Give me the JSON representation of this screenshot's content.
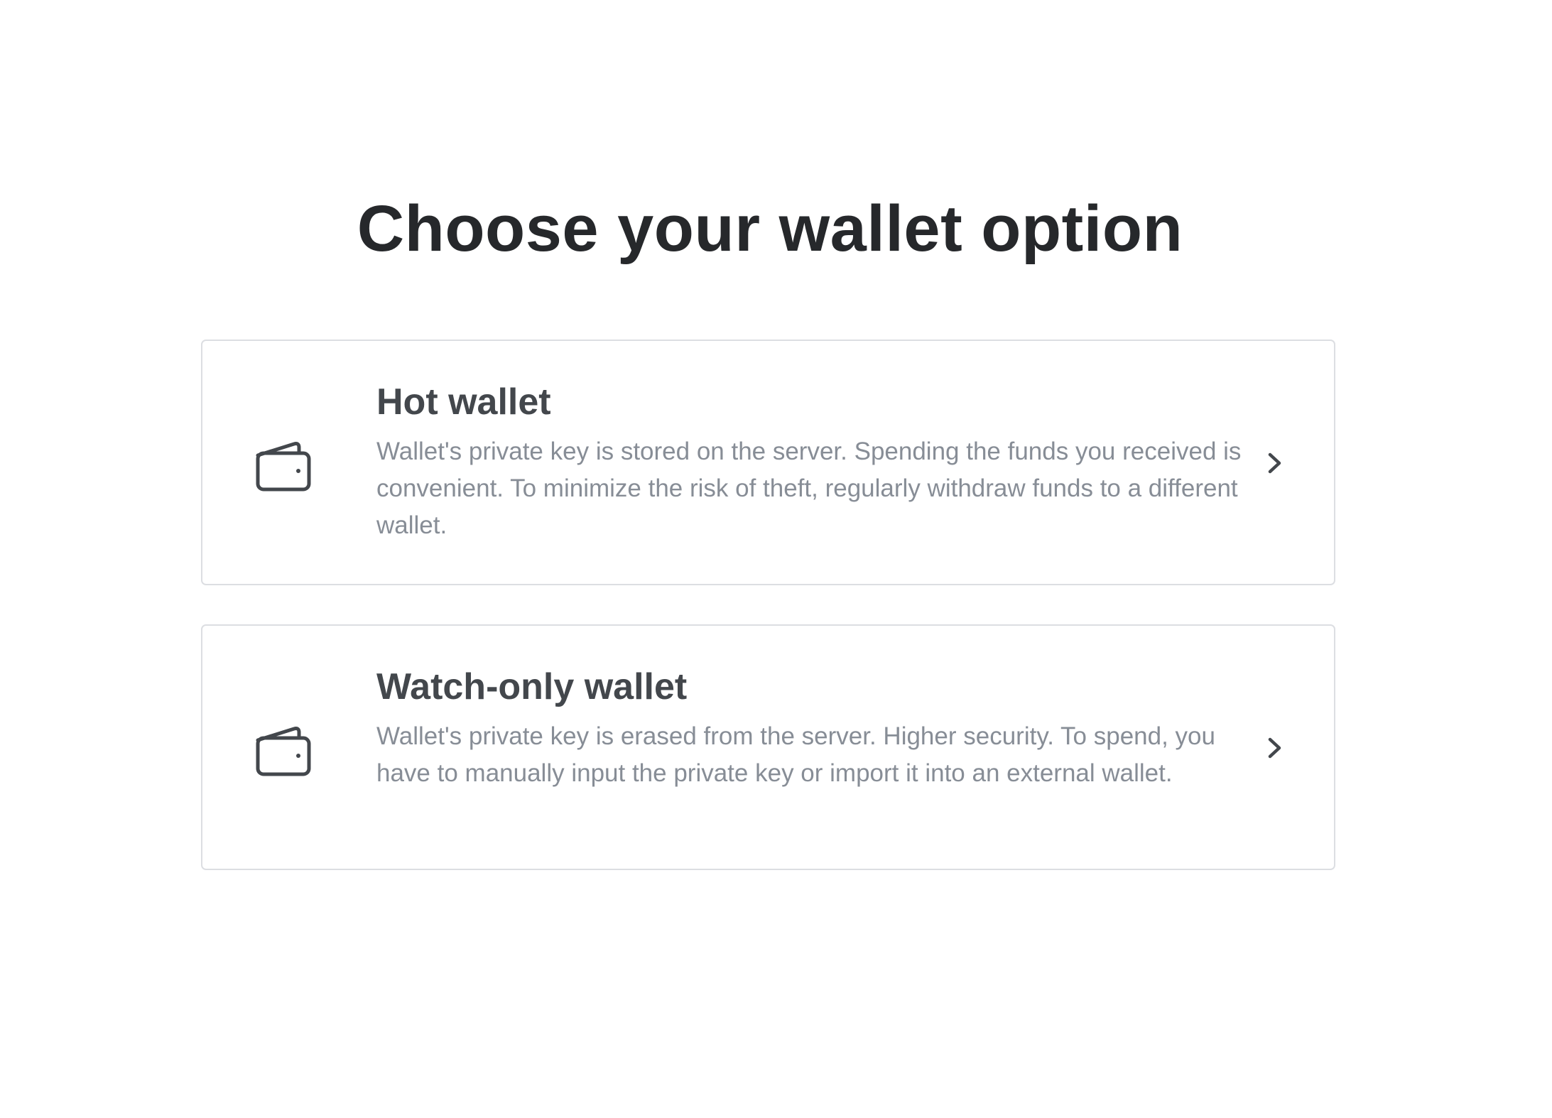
{
  "page": {
    "title": "Choose your wallet option"
  },
  "options": [
    {
      "icon": "wallet-icon",
      "title": "Hot wallet",
      "description": "Wallet's private key is stored on the server. Spending the funds you received is convenient. To minimize the risk of theft, regularly withdraw funds to a different wallet.",
      "action_icon": "chevron-right-icon"
    },
    {
      "icon": "wallet-icon",
      "title": "Watch-only wallet",
      "description": "Wallet's private key is erased from the server. Higher security. To spend, you have to manually input the private key or import it into an external wallet.",
      "action_icon": "chevron-right-icon"
    }
  ],
  "colors": {
    "title": "#26282b",
    "card_title": "#43474c",
    "description": "#878d96",
    "card_border": "#dcdee2",
    "icon": "#43474c"
  }
}
